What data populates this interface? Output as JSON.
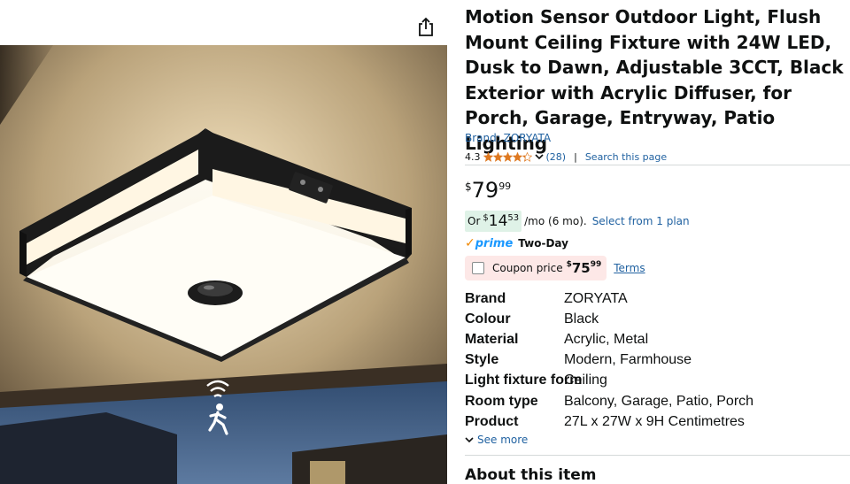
{
  "product": {
    "title": "Motion Sensor Outdoor Light, Flush Mount Ceiling Fixture with 24W LED, Dusk to Dawn, Adjustable 3CCT, Black Exterior with Acrylic Diffuser, for Porch, Garage, Entryway, Patio Lighting",
    "brand_link": "Brand: ZORYATA",
    "rating": "4.3",
    "stars_value": 4.3,
    "review_count": "(28)",
    "separator": "|",
    "search_page": "Search this page"
  },
  "price": {
    "currency": "$",
    "whole": "79",
    "fraction": "99"
  },
  "monthly": {
    "prefix": "Or",
    "currency": "$",
    "whole": "14",
    "fraction": "53",
    "suffix": "/mo (6 mo).",
    "plan_link": "Select from 1 plan"
  },
  "prime": {
    "check": "✓",
    "word": "prime",
    "delivery": "Two-Day"
  },
  "coupon": {
    "label": "Coupon price",
    "currency": "$",
    "whole": "75",
    "fraction": "99",
    "terms": "Terms"
  },
  "specs": [
    {
      "key": "Brand",
      "value": "ZORYATA"
    },
    {
      "key": "Colour",
      "value": "Black"
    },
    {
      "key": "Material",
      "value": "Acrylic, Metal"
    },
    {
      "key": "Style",
      "value": "Modern, Farmhouse"
    },
    {
      "key": "Light fixture form",
      "value": "Ceiling"
    },
    {
      "key": "Room type",
      "value": "Balcony, Garage, Patio, Porch"
    },
    {
      "key": "Product",
      "value": "27L x 27W x 9H Centimetres"
    }
  ],
  "see_more": "See more",
  "about_heading": "About this item",
  "icons": {
    "share": "share-icon",
    "star": "star-icon",
    "chevron": "chevron-down-icon",
    "motion": "motion-sensor-icon"
  },
  "colors": {
    "link": "#2162a1",
    "star": "#de7921",
    "monthly_bg": "#dff2e7",
    "coupon_bg": "#fde8e7",
    "prime_blue": "#1a98ff",
    "prime_orange": "#f08804"
  }
}
